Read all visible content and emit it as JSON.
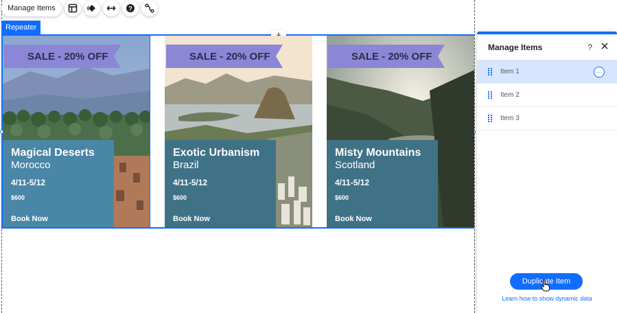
{
  "toolbar": {
    "manage_label": "Manage Items",
    "icons": [
      "layout-icon",
      "design-icon",
      "stretch-icon",
      "help-icon",
      "connect-icon"
    ]
  },
  "repeater": {
    "tag_label": "Repeater",
    "cards": [
      {
        "sale": "SALE - 20% OFF",
        "destination": "Magical Deserts",
        "country": "Morocco",
        "dates": "4/11-5/12",
        "price": "$600",
        "cta": "Book Now"
      },
      {
        "sale": "SALE - 20% OFF",
        "destination": "Exotic Urbanism",
        "country": "Brazil",
        "dates": "4/11-5/12",
        "price": "$600",
        "cta": "Book Now"
      },
      {
        "sale": "SALE - 20% OFF",
        "destination": "Misty Mountains",
        "country": "Scotland",
        "dates": "4/11-5/12",
        "price": "$600",
        "cta": "Book Now"
      }
    ]
  },
  "panel": {
    "title": "Manage Items",
    "help": "?",
    "items": [
      {
        "label": "Item 1",
        "selected": true
      },
      {
        "label": "Item 2",
        "selected": false
      },
      {
        "label": "Item 3",
        "selected": false
      }
    ],
    "duplicate_label": "Duplicate Item",
    "learn_link": "Learn how to show dynamic data"
  },
  "colors": {
    "accent": "#116dff",
    "ribbon": "#8b86d6",
    "info_box": "#3f7287",
    "selected_row": "#d7e6ff"
  }
}
